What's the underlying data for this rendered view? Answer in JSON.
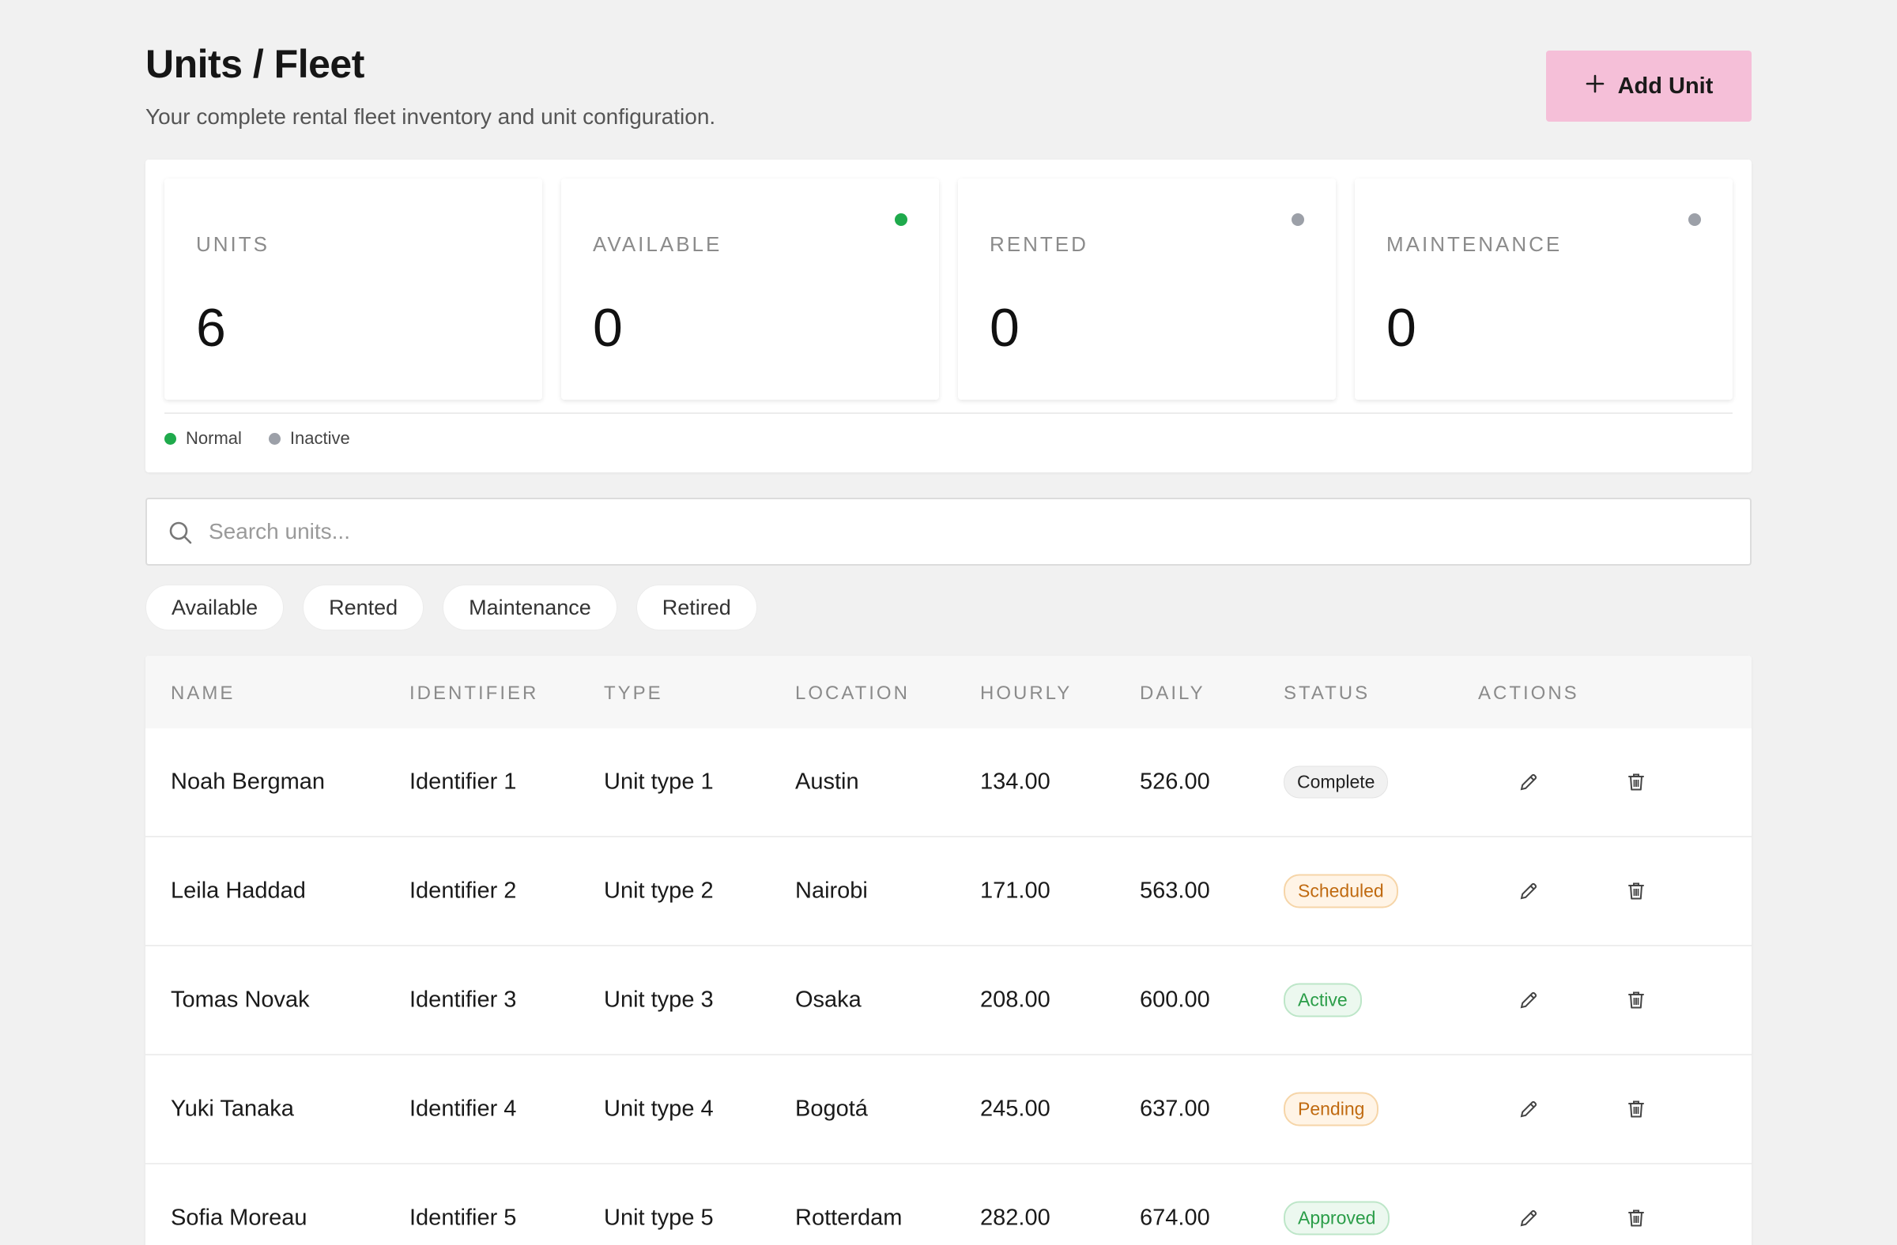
{
  "header": {
    "title": "Units / Fleet",
    "subtitle": "Your complete rental fleet inventory and unit configuration.",
    "add_button_icon": "plus-icon",
    "add_button_label": "Add Unit",
    "add_button_color": "#f5bfd8"
  },
  "stats": [
    {
      "label": "UNITS",
      "value": "6",
      "dot": null
    },
    {
      "label": "AVAILABLE",
      "value": "0",
      "dot": "#1faa4c"
    },
    {
      "label": "RENTED",
      "value": "0",
      "dot": "#9ca0a8"
    },
    {
      "label": "MAINTENANCE",
      "value": "0",
      "dot": "#9ca0a8"
    }
  ],
  "legend": [
    {
      "label": "Normal",
      "color": "#1faa4c"
    },
    {
      "label": "Inactive",
      "color": "#9ca0a8"
    }
  ],
  "search": {
    "placeholder": "Search units...",
    "icon": "search-icon"
  },
  "filters": [
    "Available",
    "Rented",
    "Maintenance",
    "Retired"
  ],
  "table": {
    "columns": [
      "NAME",
      "IDENTIFIER",
      "TYPE",
      "LOCATION",
      "HOURLY",
      "DAILY",
      "STATUS",
      "ACTIONS"
    ],
    "rows": [
      {
        "name": "Noah Bergman",
        "identifier": "Identifier 1",
        "type": "Unit type 1",
        "location": "Austin",
        "hourly": "134.00",
        "daily": "526.00",
        "status": "Complete"
      },
      {
        "name": "Leila Haddad",
        "identifier": "Identifier 2",
        "type": "Unit type 2",
        "location": "Nairobi",
        "hourly": "171.00",
        "daily": "563.00",
        "status": "Scheduled"
      },
      {
        "name": "Tomas Novak",
        "identifier": "Identifier 3",
        "type": "Unit type 3",
        "location": "Osaka",
        "hourly": "208.00",
        "daily": "600.00",
        "status": "Active"
      },
      {
        "name": "Yuki Tanaka",
        "identifier": "Identifier 4",
        "type": "Unit type 4",
        "location": "Bogotá",
        "hourly": "245.00",
        "daily": "637.00",
        "status": "Pending"
      },
      {
        "name": "Sofia Moreau",
        "identifier": "Identifier 5",
        "type": "Unit type 5",
        "location": "Rotterdam",
        "hourly": "282.00",
        "daily": "674.00",
        "status": "Approved"
      }
    ],
    "action_icons": [
      "pencil-icon",
      "trash-icon"
    ]
  }
}
